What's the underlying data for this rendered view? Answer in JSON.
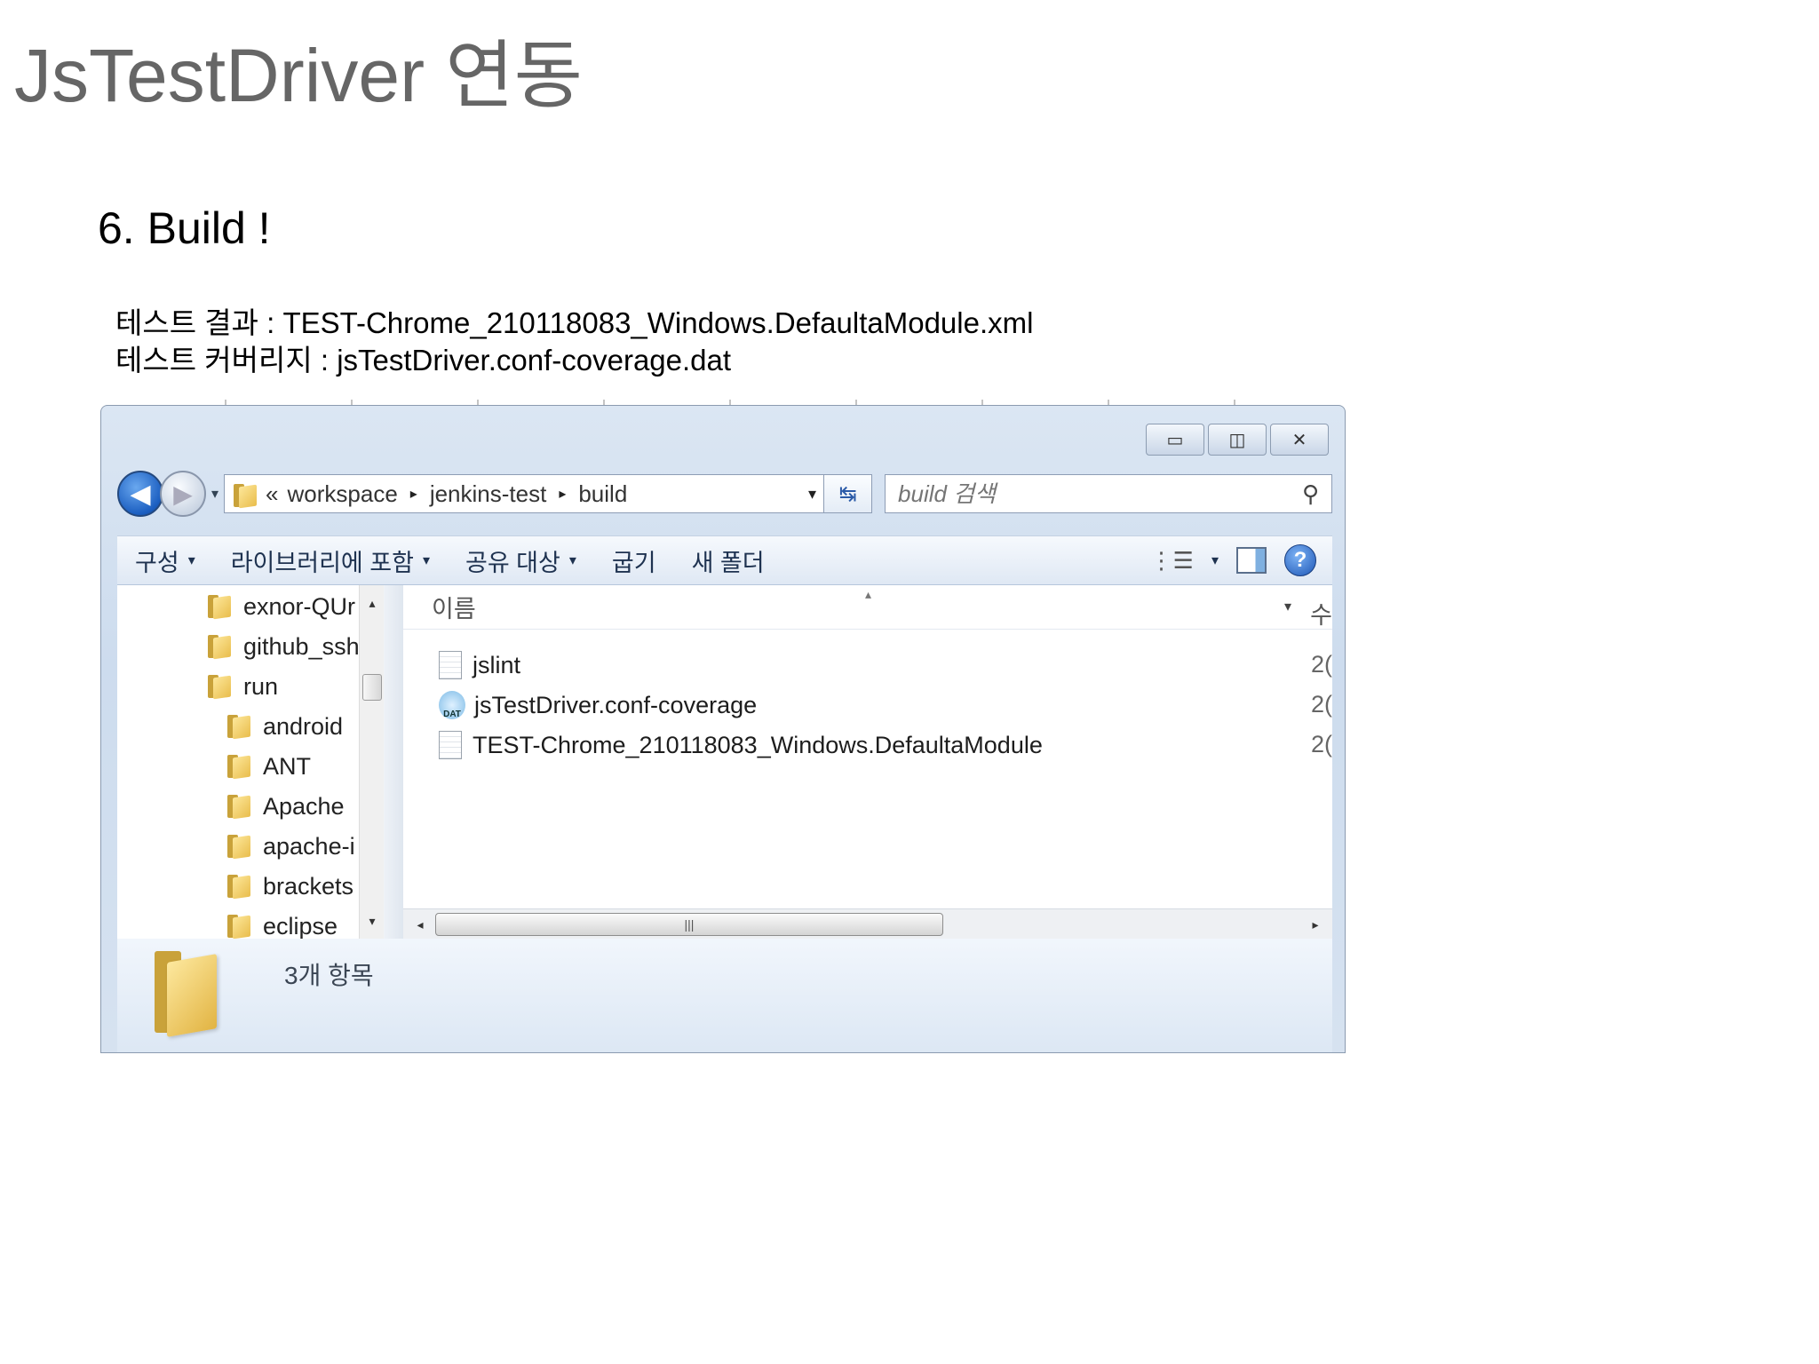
{
  "slide": {
    "title": "JsTestDriver 연동",
    "step": "6.  Build !",
    "result_line": "테스트 결과  : TEST-Chrome_210118083_Windows.DefaultaModule.xml",
    "coverage_line": "테스트 커버리지 : jsTestDriver.conf-coverage.dat"
  },
  "explorer": {
    "caption": {
      "minimize": "▭",
      "maximize": "◫",
      "close": "✕"
    },
    "nav": {
      "back": "◀",
      "forward": "▶",
      "history": "▾"
    },
    "address": {
      "prefix": "«",
      "crumbs": [
        "workspace",
        "jenkins-test",
        "build"
      ],
      "separator": "▸",
      "dropdown": "▾",
      "refresh": "↹"
    },
    "search": {
      "placeholder": "build 검색",
      "icon": "⚲"
    },
    "commands": [
      {
        "label": "구성",
        "caret": "▾"
      },
      {
        "label": "라이브러리에 포함",
        "caret": "▾"
      },
      {
        "label": "공유 대상",
        "caret": "▾"
      },
      {
        "label": "굽기",
        "caret": ""
      },
      {
        "label": "새 폴더",
        "caret": ""
      }
    ],
    "view_controls": {
      "view": "⋮☰",
      "view_caret": "▾",
      "help": "?"
    },
    "tree": [
      {
        "label": "exnor-QUr",
        "indent": 0
      },
      {
        "label": "github_ssh",
        "indent": 0
      },
      {
        "label": "run",
        "indent": 0
      },
      {
        "label": "android",
        "indent": 1
      },
      {
        "label": "ANT",
        "indent": 1
      },
      {
        "label": "Apache",
        "indent": 1
      },
      {
        "label": "apache-i",
        "indent": 1
      },
      {
        "label": "brackets",
        "indent": 1
      },
      {
        "label": "eclipse",
        "indent": 1
      }
    ],
    "tree_scroll": {
      "up": "▴",
      "down": "▾"
    },
    "list": {
      "column_name": "이름",
      "sort_arrow": "▴",
      "column_drop": "▾",
      "column_next": "수",
      "files": [
        {
          "name": "jslint",
          "icon": "doc-icon",
          "date": "2("
        },
        {
          "name": "jsTestDriver.conf-coverage",
          "icon": "dat-icon",
          "icon_text": "DAT",
          "date": "2("
        },
        {
          "name": "TEST-Chrome_210118083_Windows.DefaultaModule",
          "icon": "doc-icon",
          "date": "2("
        }
      ]
    },
    "hscroll": {
      "left": "◂",
      "right": "▸",
      "grip": "|||"
    },
    "details": {
      "item_count": "3개 항목"
    }
  }
}
